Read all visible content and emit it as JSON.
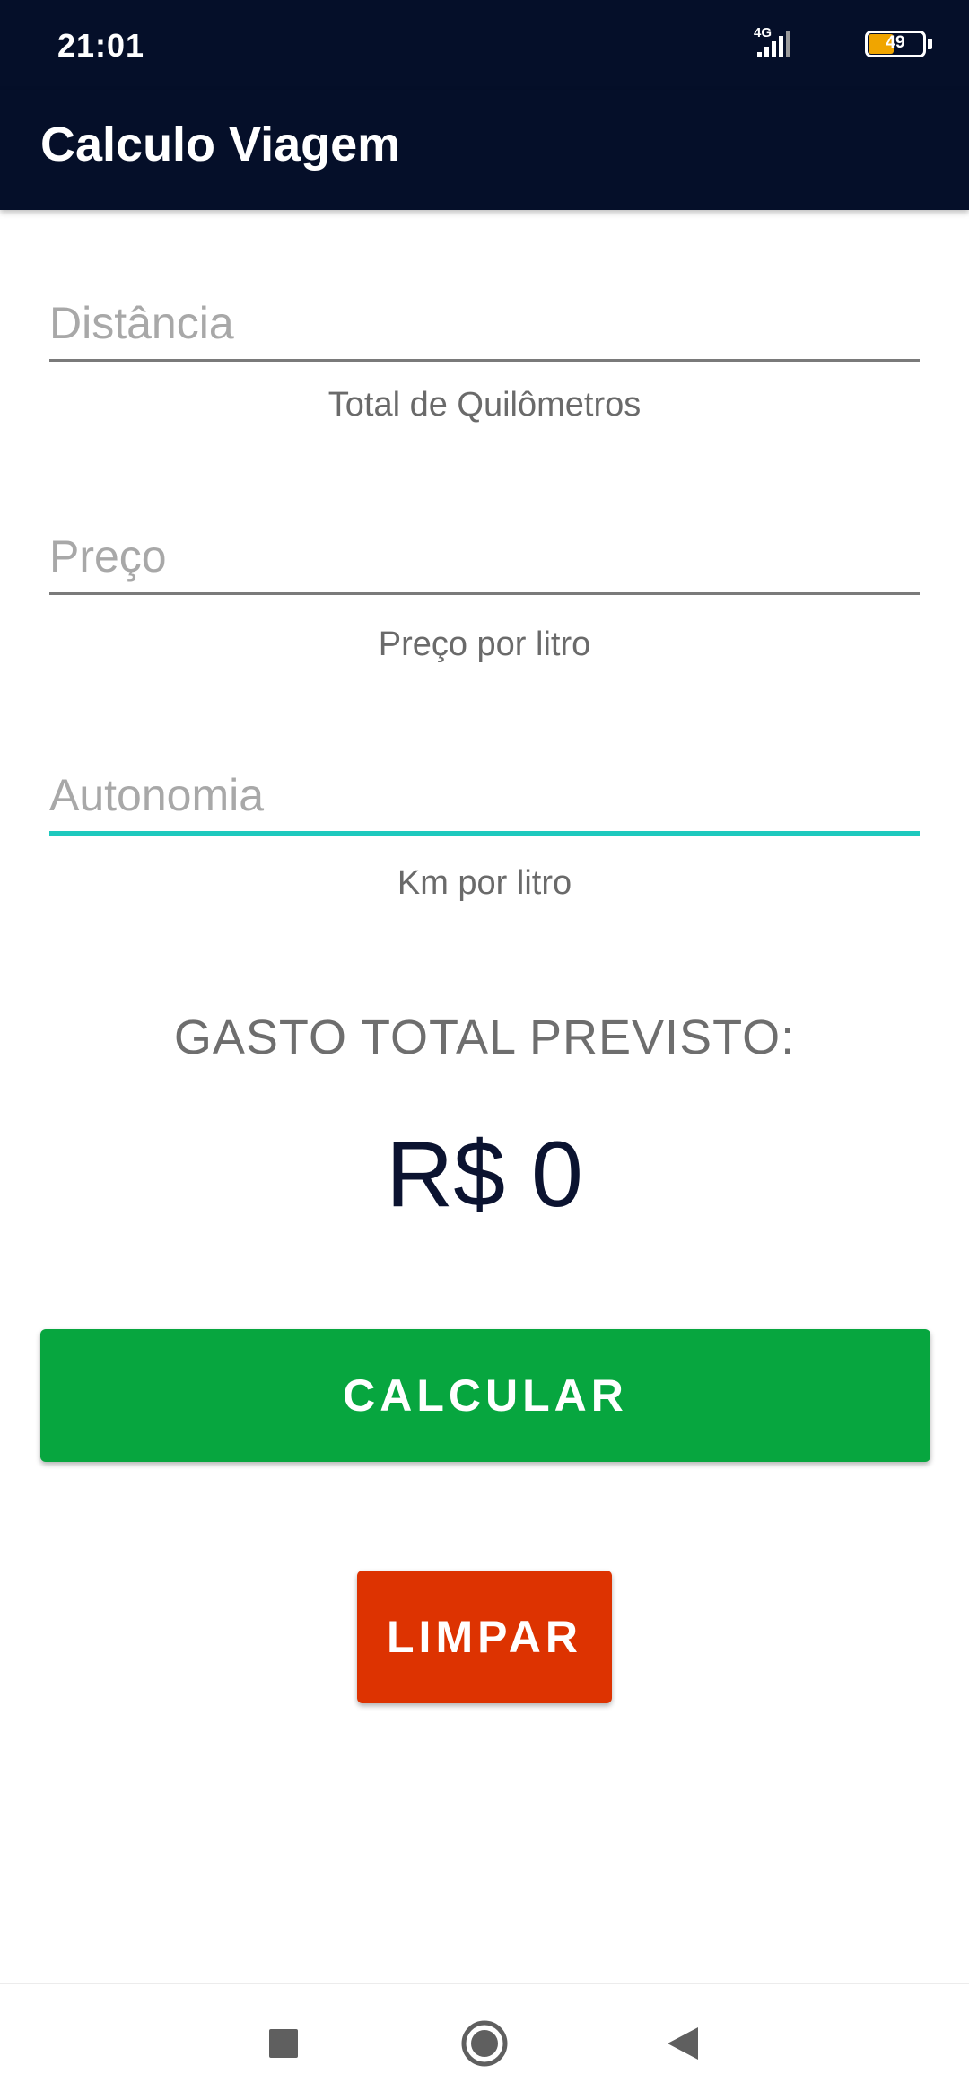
{
  "status_bar": {
    "time": "21:01",
    "network": "4G",
    "battery_level": "49",
    "battery_color": "#f0a500"
  },
  "toolbar": {
    "title": "Calculo Viagem",
    "background": "#050f29"
  },
  "form": {
    "distance": {
      "placeholder": "Distância",
      "value": "",
      "helper": "Total de Quilômetros"
    },
    "price": {
      "placeholder": "Preço",
      "value": "",
      "helper": "Preço por litro"
    },
    "autonomy": {
      "placeholder": "Autonomia",
      "value": "",
      "helper": "Km por litro",
      "focused": true
    }
  },
  "result": {
    "label": "GASTO TOTAL PREVISTO:",
    "value": "R$ 0"
  },
  "buttons": {
    "calculate": {
      "label": "CALCULAR",
      "color": "#07a63f"
    },
    "clear": {
      "label": "LIMPAR",
      "color": "#dd3301"
    }
  },
  "nav_bar": {
    "recents_icon": "square-stop-icon",
    "home_icon": "circle-home-icon",
    "back_icon": "triangle-back-icon"
  }
}
